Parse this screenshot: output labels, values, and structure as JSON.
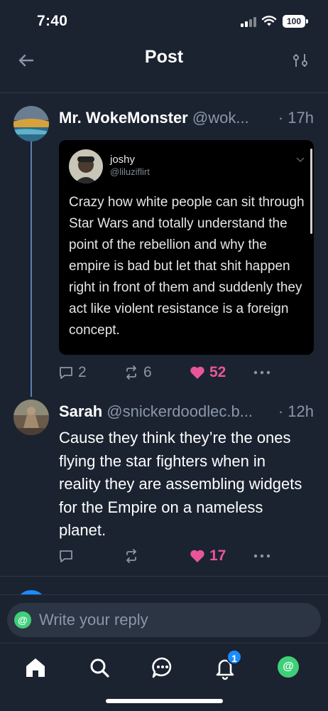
{
  "status_bar": {
    "time": "7:40",
    "battery": "100"
  },
  "header": {
    "title": "Post",
    "back_icon": "arrow-left-icon",
    "filter_icon": "sliders-icon"
  },
  "main_post": {
    "author_name": "Mr. WokeMonster",
    "author_handle": "@wok...",
    "time": "· 17h",
    "embed": {
      "name": "joshy",
      "handle": "@liluziflirt",
      "text": "Crazy how white people can sit through Star Wars and totally understand the point of the rebellion and why the empire is bad but let that shit happen right in front of them and suddenly they act like violent resistance is a foreign concept."
    },
    "replies": "2",
    "reposts": "6",
    "likes": "52"
  },
  "reply_post": {
    "author_name": "Sarah",
    "author_handle": "@snickerdoodlec.b...",
    "time": "· 12h",
    "text": "Cause they think they’re the ones flying the star fighters when in reality they are assembling widgets for the Empire on a nameless planet.",
    "likes": "17"
  },
  "composer": {
    "placeholder": "Write your reply",
    "at_symbol": "@"
  },
  "bottom_nav": {
    "items": [
      "home-icon",
      "search-icon",
      "chat-icon",
      "bell-icon",
      "profile-icon"
    ],
    "notification_count": "1",
    "profile_symbol": "@"
  },
  "colors": {
    "background": "#1b2330",
    "accent_blue": "#1a8cff",
    "like_pink": "#e8569a",
    "muted_text": "#8a97a8",
    "thread_line": "#5d7fb3"
  }
}
